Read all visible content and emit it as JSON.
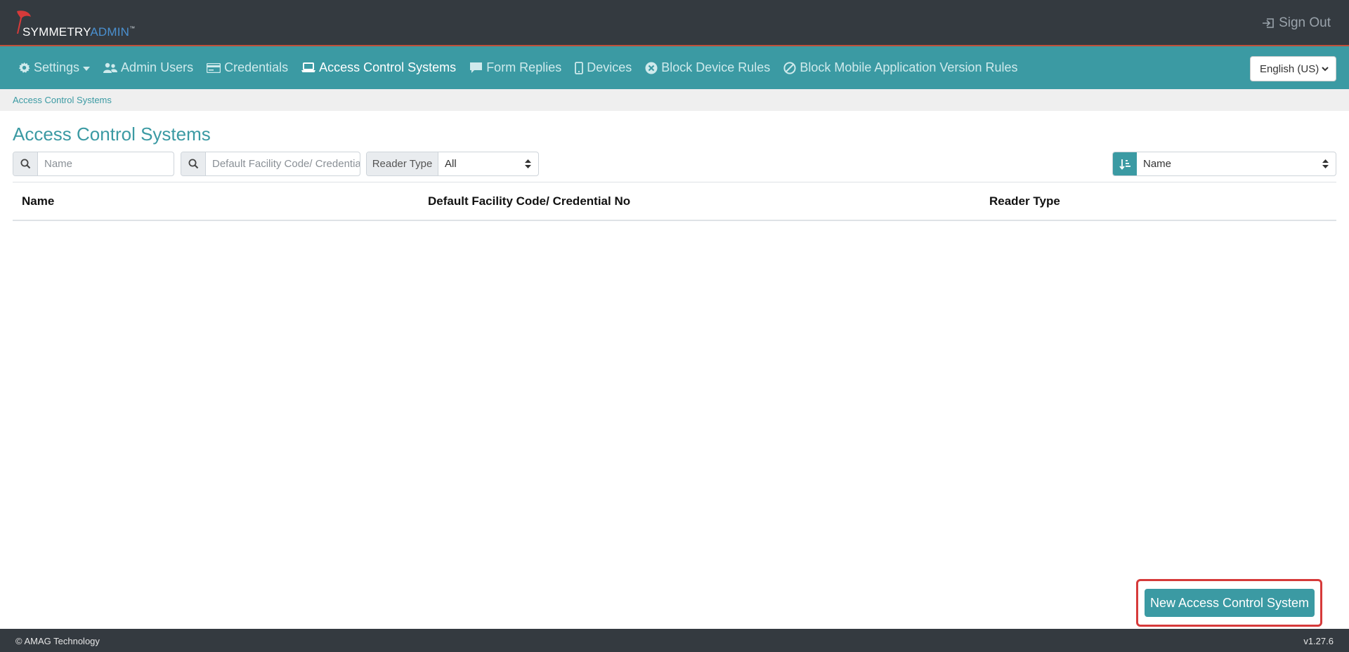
{
  "header": {
    "logo_primary": "SYMMETRY",
    "logo_secondary": "ADMIN",
    "logo_mark": "™",
    "sign_out_label": "Sign Out",
    "sign_out_icon": "sign-out-icon"
  },
  "nav": {
    "items": [
      {
        "label": "Settings",
        "icon": "gear-icon",
        "has_dropdown": true
      },
      {
        "label": "Admin Users",
        "icon": "users-icon"
      },
      {
        "label": "Credentials",
        "icon": "id-card-icon"
      },
      {
        "label": "Access Control Systems",
        "icon": "laptop-icon",
        "active": true
      },
      {
        "label": "Form Replies",
        "icon": "comment-icon"
      },
      {
        "label": "Devices",
        "icon": "mobile-icon"
      },
      {
        "label": "Block Device Rules",
        "icon": "times-circle-icon"
      },
      {
        "label": "Block Mobile Application Version Rules",
        "icon": "ban-icon"
      }
    ],
    "language": "English (US)"
  },
  "breadcrumb": {
    "current": "Access Control Systems"
  },
  "page": {
    "title": "Access Control Systems"
  },
  "filters": {
    "name_placeholder": "Name",
    "facility_placeholder": "Default Facility Code/ Credential No",
    "reader_type_label": "Reader Type",
    "reader_type_value": "All",
    "sort_value": "Name"
  },
  "table": {
    "columns": [
      "Name",
      "Default Facility Code/ Credential No",
      "Reader Type"
    ],
    "rows": []
  },
  "actions": {
    "new_label": "New Access Control System"
  },
  "footer": {
    "copyright": "© AMAG Technology",
    "version": "v1.27.6"
  },
  "colors": {
    "accent": "#3b9aa3",
    "header_bg": "#343a40",
    "highlight_border": "#d63a3a"
  }
}
